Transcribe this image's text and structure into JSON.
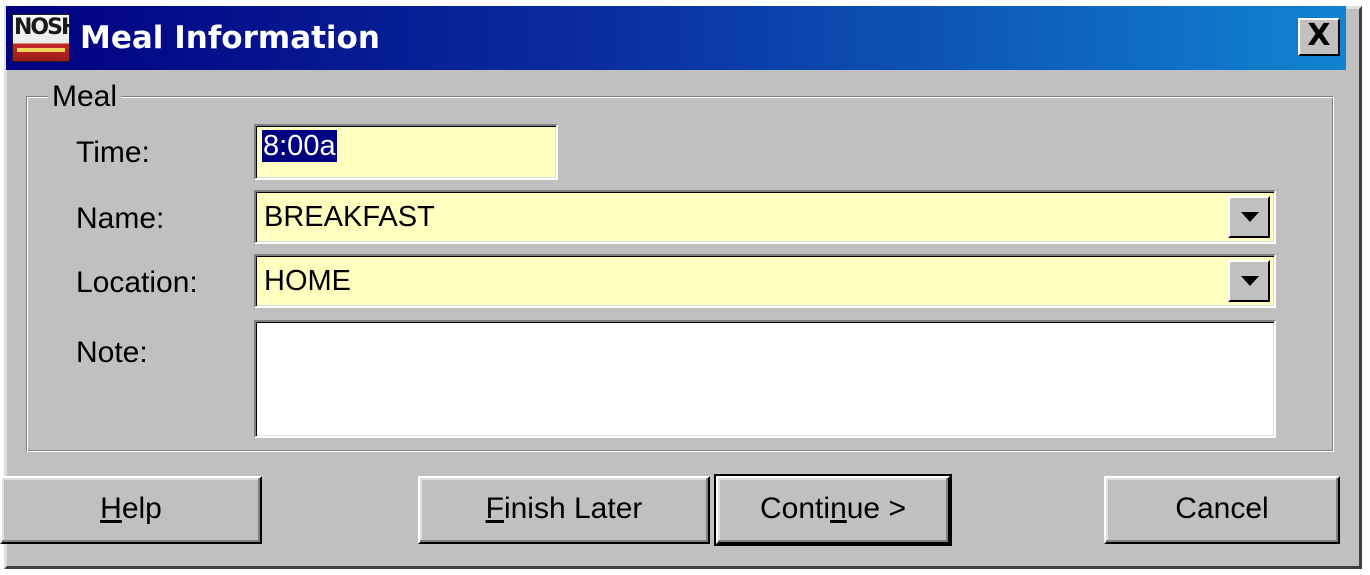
{
  "window": {
    "title": "Meal Information",
    "close_glyph": "X",
    "app_icon": "nosh-app-icon",
    "app_icon_text": "NOSH"
  },
  "group": {
    "legend": "Meal"
  },
  "fields": {
    "time": {
      "label": "Time:",
      "value": "8:00a"
    },
    "name": {
      "label": "Name:",
      "value": "BREAKFAST"
    },
    "location": {
      "label": "Location:",
      "value": "HOME"
    },
    "note": {
      "label": "Note:",
      "value": ""
    }
  },
  "buttons": {
    "help": {
      "mnemonic": "H",
      "rest": "elp"
    },
    "finish_later": {
      "mnemonic": "F",
      "rest": "inish Later"
    },
    "continue": {
      "before": "Conti",
      "mnemonic": "n",
      "after": "ue >"
    },
    "cancel": {
      "label": "Cancel"
    }
  },
  "colors": {
    "title_start": "#000080",
    "title_end": "#1084d0",
    "input_bg": "#ffffc0",
    "face": "#c0c0c0",
    "selection": "#000080"
  }
}
